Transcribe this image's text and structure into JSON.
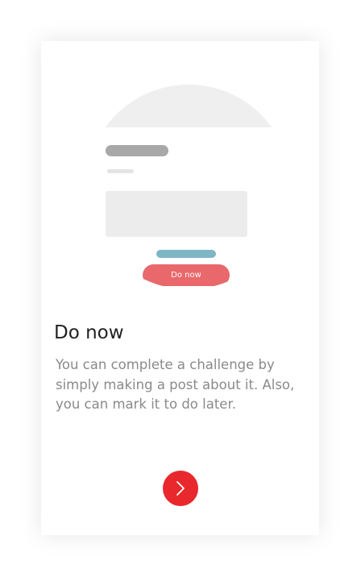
{
  "screen": {
    "title": "Do now",
    "description": "You can complete a challenge by simply making a post about it. Also, you can mark it to do later."
  },
  "illustration": {
    "button_label": "Do now"
  },
  "navigation": {
    "next_icon": "chevron-right-icon"
  },
  "colors": {
    "accent": "#e8282c",
    "illustration_button": "#e9686b",
    "illustration_teal": "#7fb6c6"
  }
}
